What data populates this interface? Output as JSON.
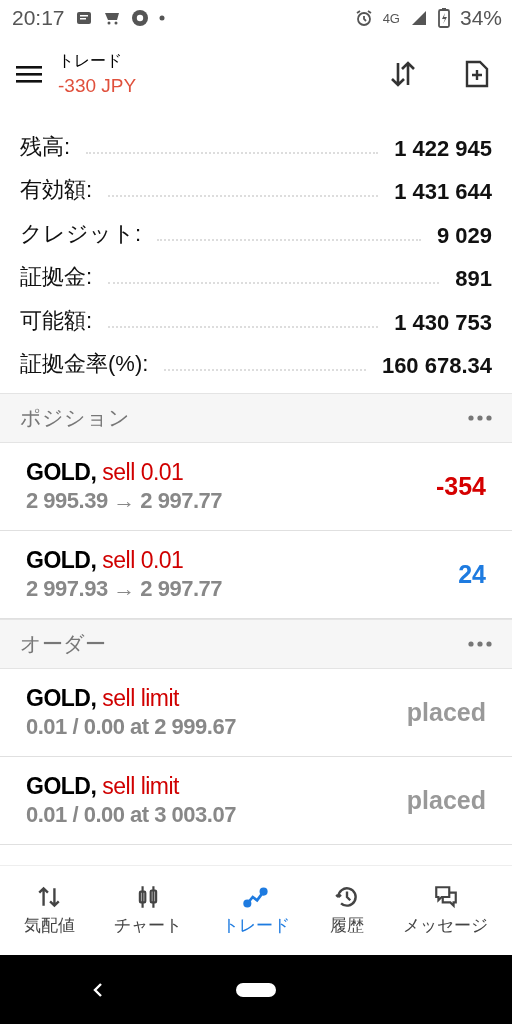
{
  "status_bar": {
    "time": "20:17",
    "network": "4G",
    "battery": "34%"
  },
  "header": {
    "title": "トレード",
    "subtitle": "-330 JPY"
  },
  "summary": [
    {
      "label": "残高:",
      "value": "1 422 945"
    },
    {
      "label": "有効額:",
      "value": "1 431 644"
    },
    {
      "label": "クレジット:",
      "value": "9 029"
    },
    {
      "label": "証拠金:",
      "value": "891"
    },
    {
      "label": "可能額:",
      "value": "1 430 753"
    },
    {
      "label": "証拠金率(%):",
      "value": "160 678.34"
    }
  ],
  "positions": {
    "title": "ポジション",
    "items": [
      {
        "symbol": "GOLD,",
        "side": "sell 0.01",
        "prices": "2 995.39 → 2 997.77",
        "profit": "-354",
        "color": "#d50000"
      },
      {
        "symbol": "GOLD,",
        "side": "sell 0.01",
        "prices": "2 997.93 → 2 997.77",
        "profit": "24",
        "color": "#1e7be0"
      }
    ]
  },
  "orders": {
    "title": "オーダー",
    "items": [
      {
        "symbol": "GOLD,",
        "side": "sell limit",
        "details": "0.01 / 0.00 at 2 999.67",
        "state": "placed"
      },
      {
        "symbol": "GOLD,",
        "side": "sell limit",
        "details": "0.01 / 0.00 at 3 003.07",
        "state": "placed"
      }
    ]
  },
  "nav": [
    {
      "label": "気配値",
      "kind": "quotes",
      "selected": false
    },
    {
      "label": "チャート",
      "kind": "chart",
      "selected": false
    },
    {
      "label": "トレード",
      "kind": "trade",
      "selected": true
    },
    {
      "label": "履歴",
      "kind": "history",
      "selected": false
    },
    {
      "label": "メッセージ",
      "kind": "messages",
      "selected": false
    }
  ]
}
